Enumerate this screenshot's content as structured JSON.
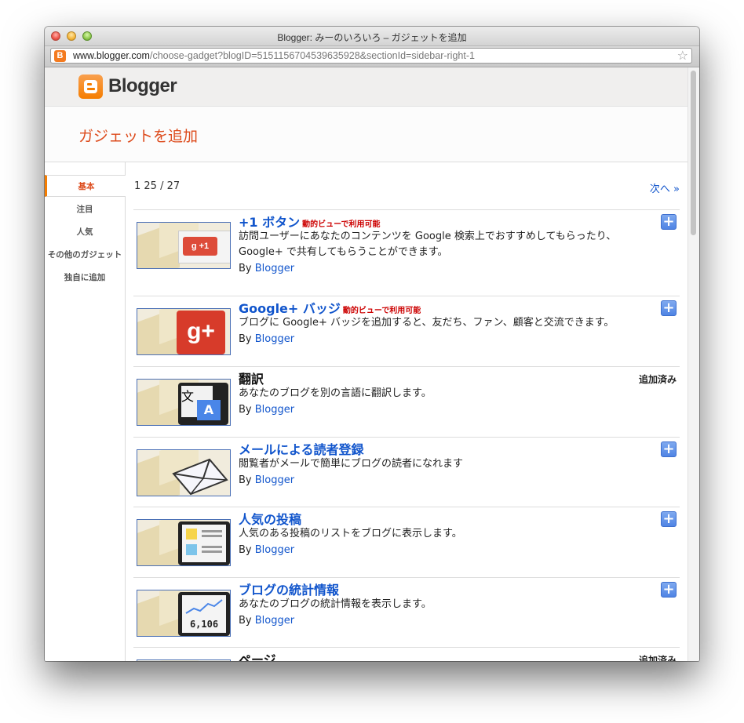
{
  "window": {
    "title": "Blogger: みーのいろいろ – ガジェットを追加"
  },
  "address_bar": {
    "domain": "www.blogger.com",
    "path": "/choose-gadget?blogID=5151156704539635928&sectionId=sidebar-right-1"
  },
  "brand": {
    "name": "Blogger"
  },
  "page": {
    "title": "ガジェットを追加",
    "pager": "1 25 / 27",
    "next": "次へ »"
  },
  "sidebar": {
    "items": [
      {
        "label": "基本"
      },
      {
        "label": "注目"
      },
      {
        "label": "人気"
      },
      {
        "label": "その他のガジェット"
      },
      {
        "label": "独自に追加"
      }
    ]
  },
  "gadgets": [
    {
      "name": "+1 ボタン",
      "badge": "動的ビューで利用可能",
      "desc": "訪問ユーザーにあなたのコンテンツを Google 検索上でおすすめしてもらったり、Google+ で共有してもらうことができます。",
      "by": "By",
      "author": "Blogger",
      "action": "+",
      "icon": "plus-one-icon"
    },
    {
      "name": "Google+ バッジ",
      "badge": "動的ビューで利用可能",
      "desc": "ブログに Google+ バッジを追加すると、友だち、ファン、顧客と交流できます。",
      "by": "By",
      "author": "Blogger",
      "action": "+",
      "icon": "google-plus-icon"
    },
    {
      "name": "翻訳",
      "desc": "あなたのブログを別の言語に翻訳します。",
      "by": "By",
      "author": "Blogger",
      "status": "追加済み",
      "icon": "translate-icon",
      "glyph_a": "文",
      "glyph_b": "A"
    },
    {
      "name": "メールによる読者登録",
      "desc": "閲覧者がメールで簡単にブログの読者になれます",
      "by": "By",
      "author": "Blogger",
      "action": "+",
      "icon": "envelope-icon"
    },
    {
      "name": "人気の投稿",
      "desc": "人気のある投稿のリストをブログに表示します。",
      "by": "By",
      "author": "Blogger",
      "action": "+",
      "icon": "popular-posts-icon"
    },
    {
      "name": "ブログの統計情報",
      "desc": "あなたのブログの統計情報を表示します。",
      "by": "By",
      "author": "Blogger",
      "action": "+",
      "icon": "stats-chart-icon",
      "counter": "6,106"
    },
    {
      "name": "ページ",
      "status": "追加済み",
      "icon": "pages-icon"
    }
  ],
  "icons": {
    "favicon": "B",
    "bookmark": "star-icon"
  },
  "colors": {
    "accent": "#dd4b1c",
    "link": "#1155cc",
    "badge": "#cc0000",
    "brand": "#f57d00"
  }
}
